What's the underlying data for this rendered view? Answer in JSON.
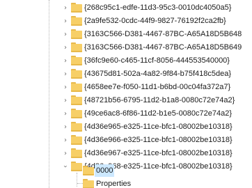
{
  "tree": {
    "rows": [
      {
        "label": "{268c95c1-edfe-11d3-95c3-0010dc4050a5}"
      },
      {
        "label": "{2a9fe532-0cdc-44f9-9827-76192f2ca2fb}"
      },
      {
        "label": "{3163C566-D381-4467-87BC-A65A18D5B648"
      },
      {
        "label": "{3163C566-D381-4467-87BC-A65A18D5B649"
      },
      {
        "label": "{36fc9e60-c465-11cf-8056-444553540000}"
      },
      {
        "label": "{43675d81-502a-4a82-9f84-b75f418c5dea}"
      },
      {
        "label": "{4658ee7e-f050-11d1-b6bd-00c04fa372a7}"
      },
      {
        "label": "{48721b56-6795-11d2-b1a8-0080c72e74a2}"
      },
      {
        "label": "{49ce6ac8-6f86-11d2-b1e5-0080c72e74a2}"
      },
      {
        "label": "{4d36e965-e325-11ce-bfc1-08002be10318}"
      },
      {
        "label": "{4d36e966-e325-11ce-bfc1-08002be10318}"
      },
      {
        "label": "{4d36e967-e325-11ce-bfc1-08002be10318}"
      },
      {
        "label": "{4d36e968-e325-11ce-bfc1-08002be10318}"
      }
    ],
    "children": [
      {
        "label": "0000"
      },
      {
        "label": "Properties"
      }
    ]
  }
}
